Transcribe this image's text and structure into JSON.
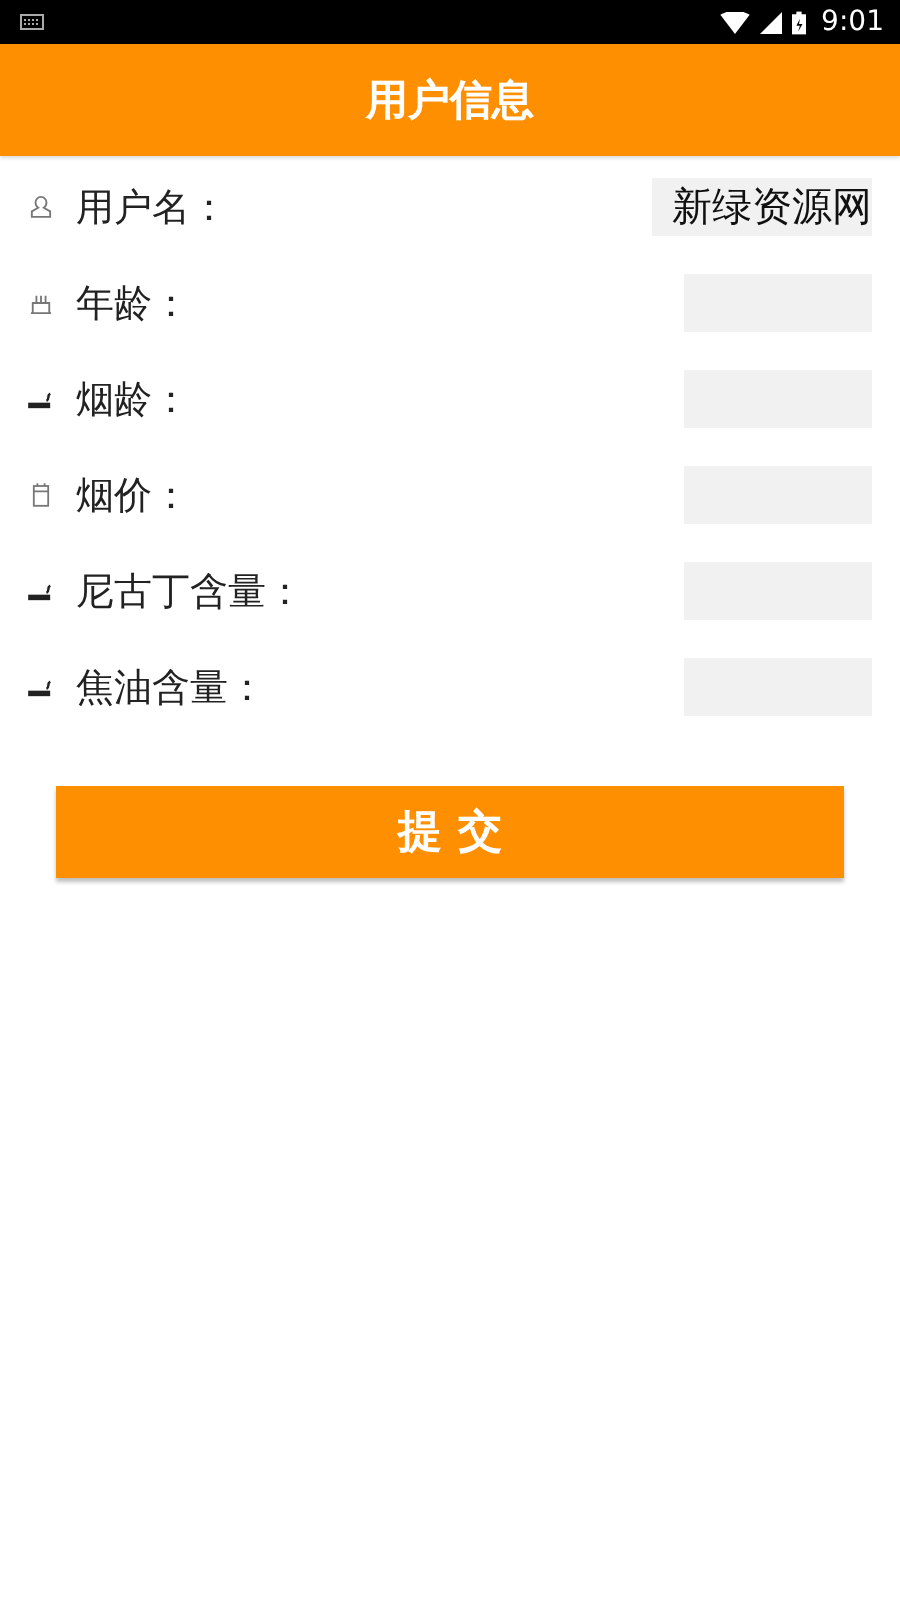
{
  "status_bar": {
    "time": "9:01"
  },
  "header": {
    "title": "用户信息"
  },
  "fields": [
    {
      "label": "用户名：",
      "value": "新绿资源网"
    },
    {
      "label": "年龄："
    },
    {
      "label": "烟龄："
    },
    {
      "label": "烟价："
    },
    {
      "label": "尼古丁含量："
    },
    {
      "label": "焦油含量："
    }
  ],
  "submit_button": {
    "label": "提 交"
  }
}
